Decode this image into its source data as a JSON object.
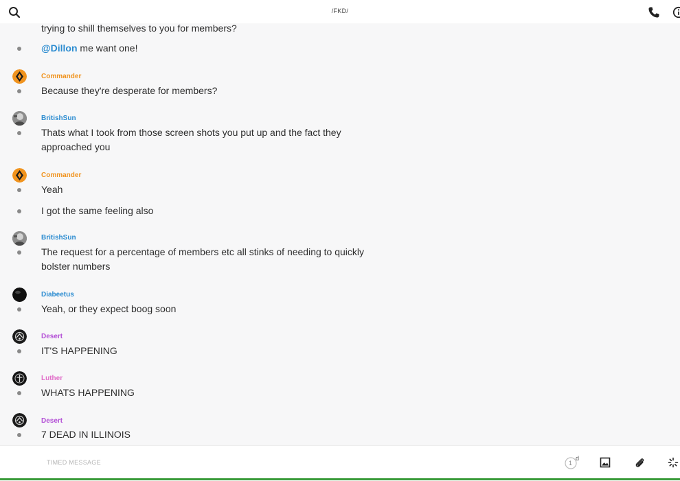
{
  "header": {
    "title": "/FKD/"
  },
  "messages": [
    {
      "text": "trying to shill themselves to you for members?"
    },
    {
      "mention": "@Dillon",
      "text": " me want one!"
    },
    {
      "author": "Commander",
      "color": "#f0931e",
      "text": "Because they're desperate for members?"
    },
    {
      "author": "BritishSun",
      "color": "#2a8bd0",
      "text": "Thats what I took from those screen shots you put up and the fact they approached you"
    },
    {
      "author": "Commander",
      "color": "#f0931e",
      "text": "Yeah"
    },
    {
      "text": "I got the same feeling also"
    },
    {
      "author": "BritishSun",
      "color": "#2a8bd0",
      "text": "The request for a percentage of members etc all stinks of needing to quickly bolster numbers"
    },
    {
      "author": "Diabeetus",
      "color": "#2a8bd0",
      "text": "Yeah, or they expect boog soon"
    },
    {
      "author": "Desert",
      "color": "#b34fd6",
      "text": "IT'S HAPPENING"
    },
    {
      "author": "Luther",
      "color": "#e06cc8",
      "text": "WHATS HAPPENING"
    },
    {
      "author": "Desert",
      "color": "#b34fd6",
      "text": "7 DEAD IN ILLINOIS"
    }
  ],
  "composer": {
    "placeholder": "TIMED MESSAGE",
    "timer_value": "1",
    "timer_unit": "d",
    "icons": [
      "timer-icon",
      "image-icon",
      "paperclip-icon",
      "burst-icon"
    ]
  },
  "header_icons": [
    "search-icon",
    "phone-icon",
    "info-icon"
  ]
}
